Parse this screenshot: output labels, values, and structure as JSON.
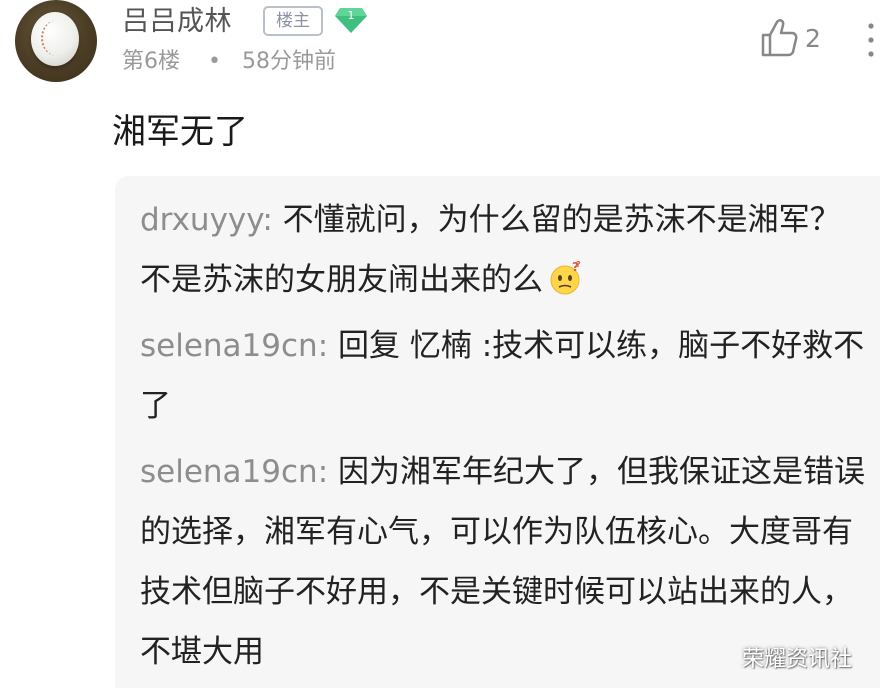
{
  "comment": {
    "author": "吕吕成林",
    "op_badge": "楼主",
    "level_badge": "1",
    "floor": "第6楼",
    "separator": "•",
    "time": "58分钟前",
    "like_count": "2",
    "text": "湘军无了"
  },
  "replies": [
    {
      "author": "drxuyyy:",
      "text": " 不懂就问，为什么留的是苏沫不是湘军？不是苏沫的女朋友闹出来的么",
      "emoji": "thinking-face-icon"
    },
    {
      "author": "selena19cn:",
      "text": " 回复 忆楠 :技术可以练，脑子不好救不了"
    },
    {
      "author": "selena19cn:",
      "text": " 因为湘军年纪大了，但我保证这是错误的选择，湘军有心气，可以作为队伍核心。大度哥有技术但脑子不好用，不是关键时候可以站出来的人，不堪大用"
    }
  ],
  "watermark": "荣耀资讯社",
  "colors": {
    "level_badge": "#3fc07f",
    "reply_background": "#f6f6f6",
    "author_gray": "#8d8d8d"
  }
}
